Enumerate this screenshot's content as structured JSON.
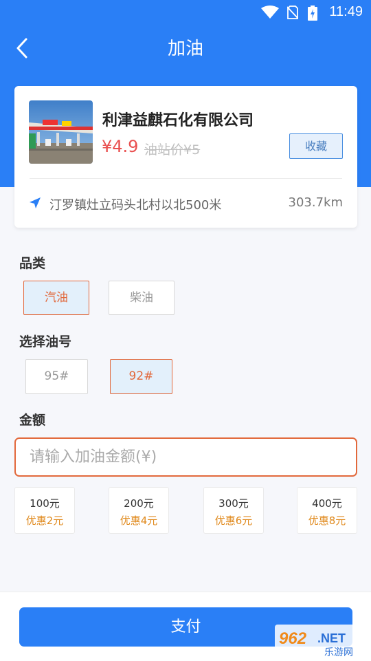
{
  "status_bar": {
    "time": "11:49"
  },
  "header": {
    "title": "加油"
  },
  "station": {
    "name": "利津益麒石化有限公司",
    "price": "¥4.9",
    "original_price": "油站价¥5",
    "favorite_label": "收藏",
    "address": "汀罗镇灶立码头北村以北500米",
    "distance": "303.7km"
  },
  "category": {
    "label": "品类",
    "options": [
      "汽油",
      "柴油"
    ],
    "selected": "汽油"
  },
  "grade": {
    "label": "选择油号",
    "options": [
      "95#",
      "92#"
    ],
    "selected": "92#"
  },
  "amount": {
    "label": "金额",
    "placeholder": "请输入加油金额(¥)",
    "value": "",
    "presets": [
      {
        "amount": "100元",
        "discount": "优惠2元"
      },
      {
        "amount": "200元",
        "discount": "优惠4元"
      },
      {
        "amount": "300元",
        "discount": "优惠6元"
      },
      {
        "amount": "400元",
        "discount": "优惠8元"
      }
    ]
  },
  "pay_label": "支付",
  "watermark": {
    "text": "962.NET",
    "subtext": "乐游网"
  },
  "colors": {
    "primary": "#2a7ff6",
    "accent": "#e2683b",
    "price": "#e94f4f",
    "discount": "#e08a1e"
  }
}
